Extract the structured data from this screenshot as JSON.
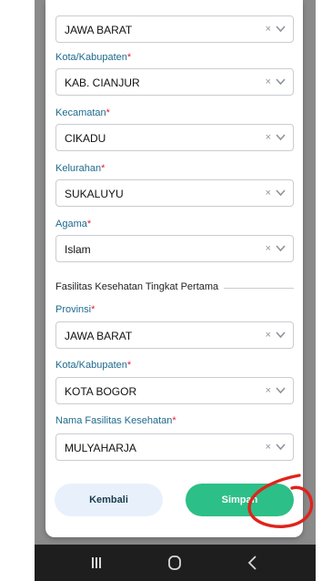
{
  "form": {
    "fields": [
      {
        "label": "",
        "value": "JAWA BARAT"
      },
      {
        "label": "Kota/Kabupaten",
        "value": "KAB. CIANJUR"
      },
      {
        "label": "Kecamatan",
        "value": "CIKADU"
      },
      {
        "label": "Kelurahan",
        "value": "SUKALUYU"
      },
      {
        "label": "Agama",
        "value": "Islam"
      }
    ],
    "required_mark": "*",
    "clear_symbol": "×"
  },
  "faskes": {
    "section_title": "Fasilitas Kesehatan Tingkat Pertama",
    "fields": [
      {
        "label": "Provinsi",
        "value": "JAWA BARAT"
      },
      {
        "label": "Kota/Kabupaten",
        "value": "KOTA BOGOR"
      },
      {
        "label": "Nama Fasilitas Kesehatan",
        "value": "MULYAHARJA"
      }
    ]
  },
  "actions": {
    "back_label": "Kembali",
    "save_label": "Simpan"
  },
  "navbar": {
    "icons": [
      "recent-apps-icon",
      "home-icon",
      "back-icon"
    ]
  },
  "colors": {
    "label": "#1d6a8e",
    "required": "#e0223a",
    "save": "#2dbf88",
    "back": "#e8f1fb",
    "annotation": "#e0231b"
  }
}
